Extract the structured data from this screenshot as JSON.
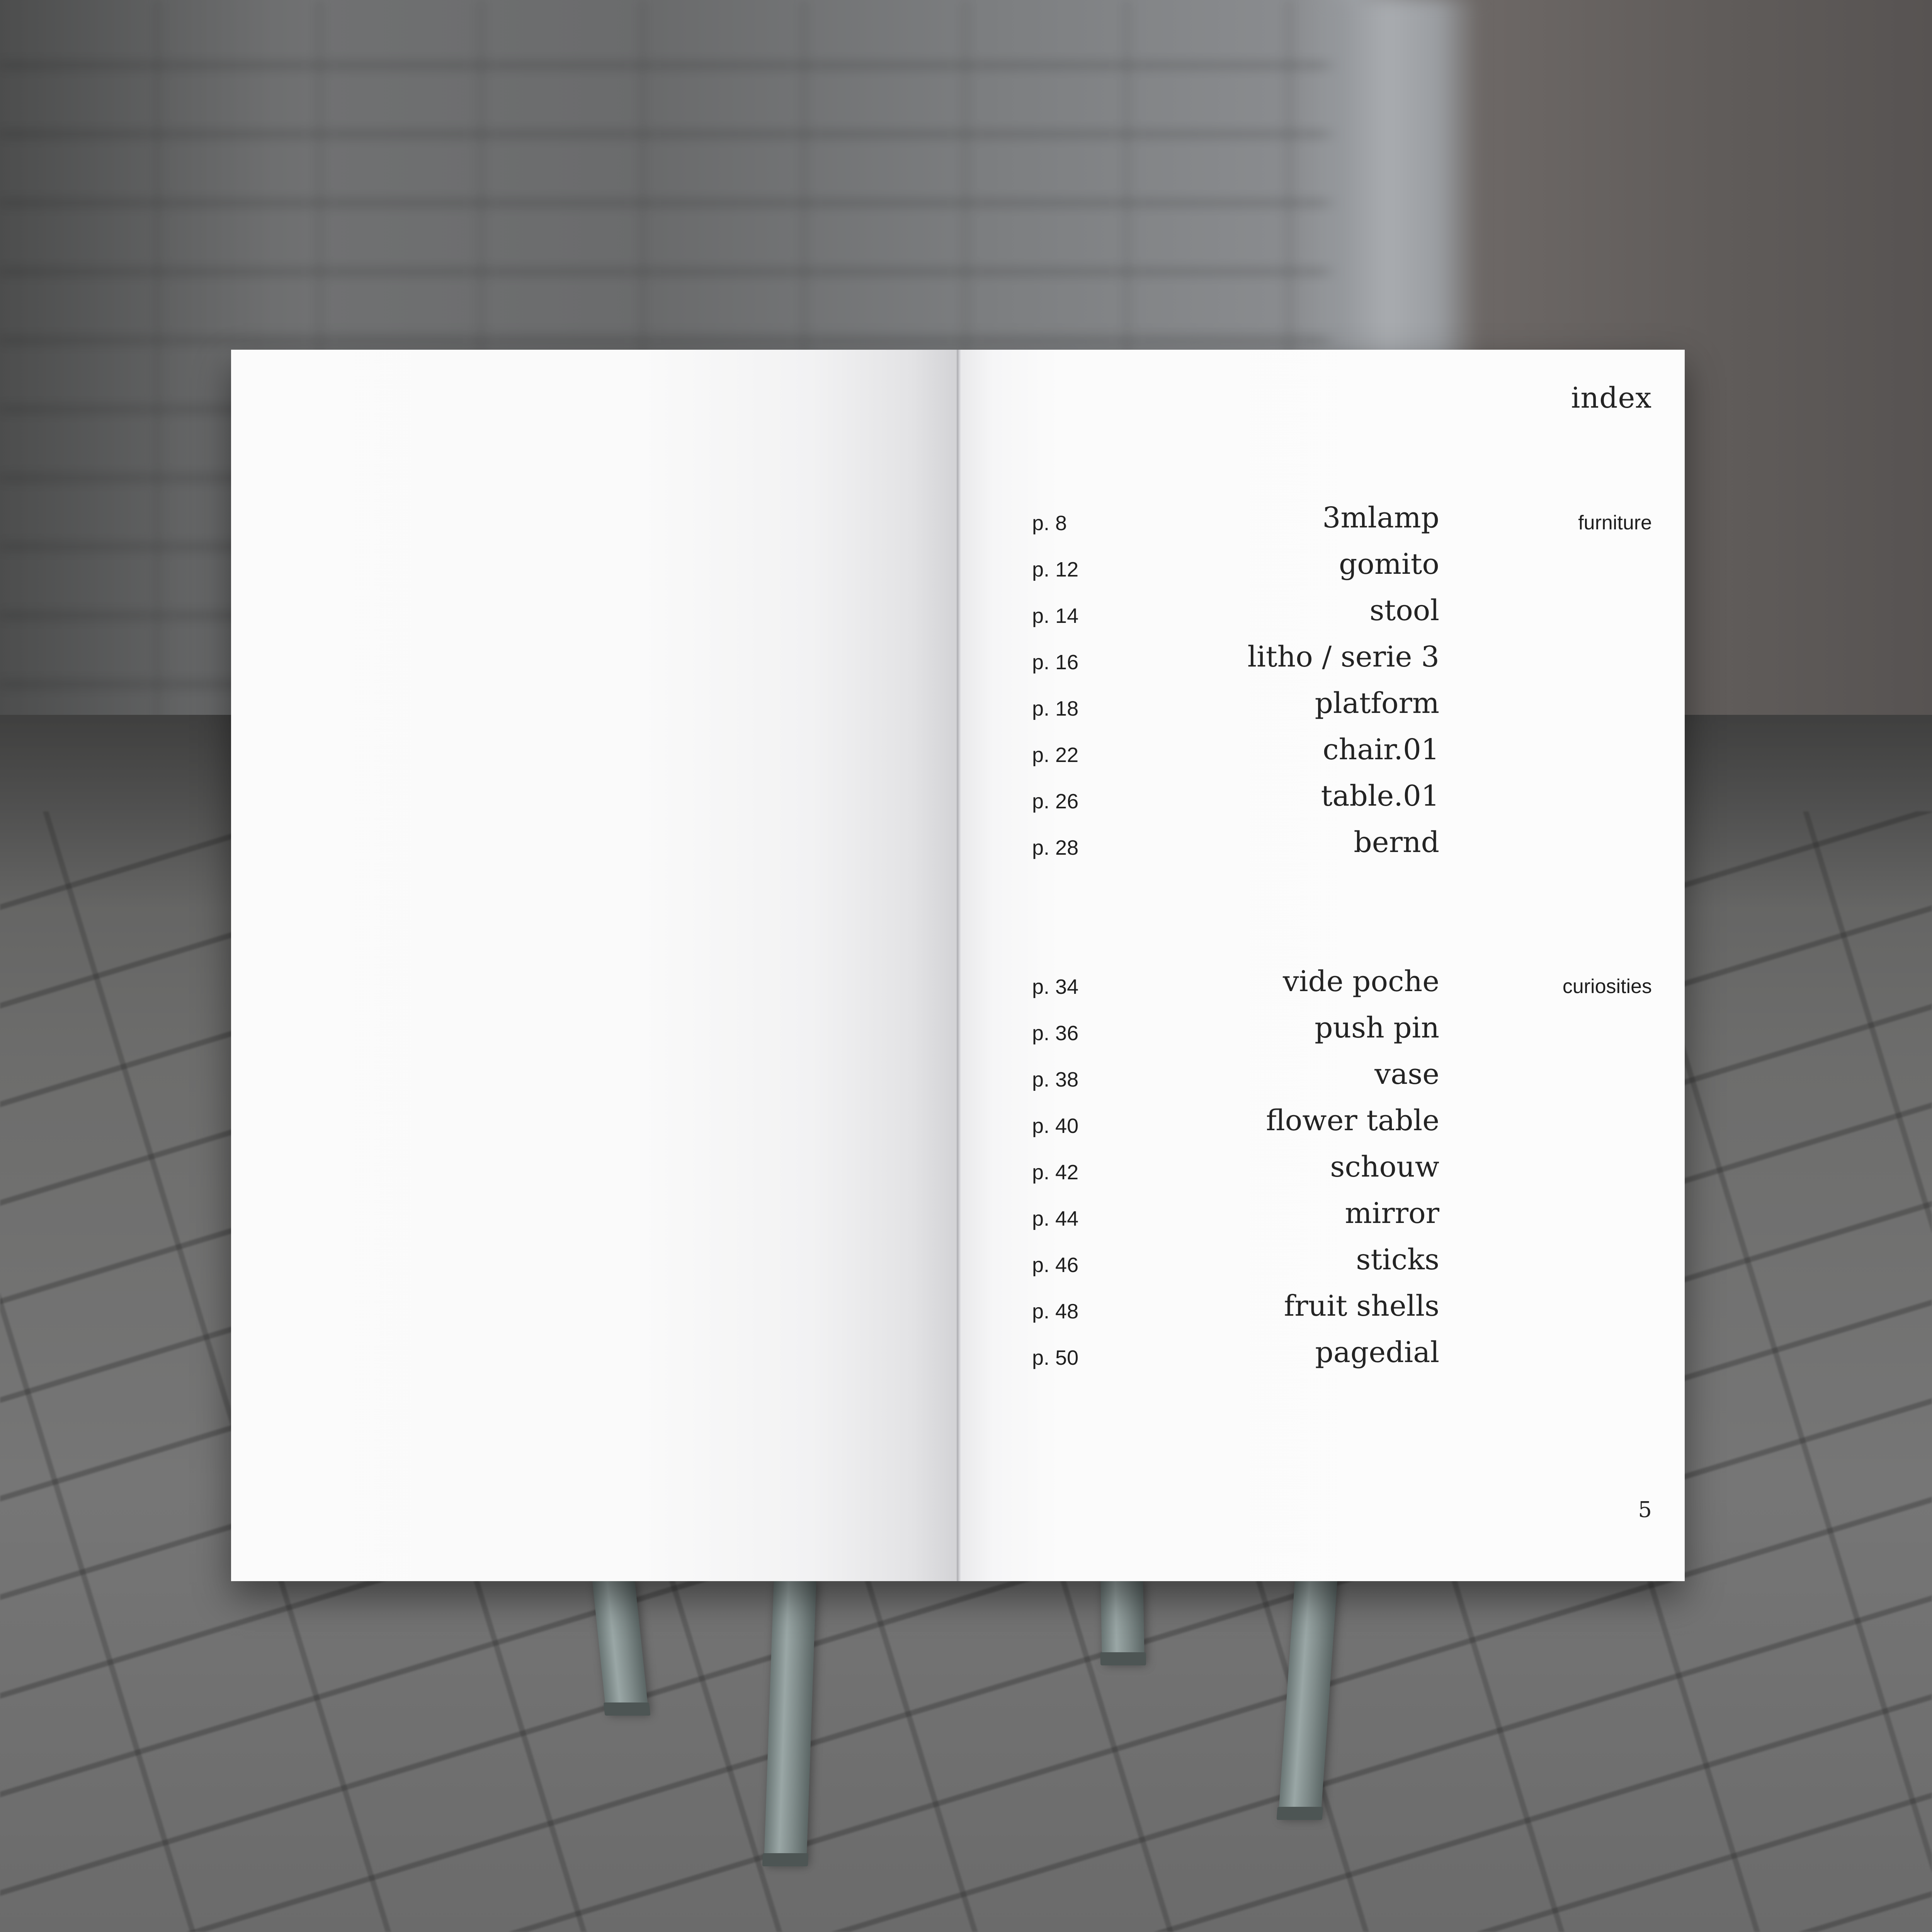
{
  "booklet": {
    "index_title": "index",
    "folio": "5",
    "sections": [
      {
        "label": "furniture",
        "entries": [
          {
            "page": "p. 8",
            "title": "3mlamp"
          },
          {
            "page": "p. 12",
            "title": "gomito"
          },
          {
            "page": "p. 14",
            "title": "stool"
          },
          {
            "page": "p. 16",
            "title": "litho / serie 3"
          },
          {
            "page": "p. 18",
            "title": "platform"
          },
          {
            "page": "p. 22",
            "title": "chair.01"
          },
          {
            "page": "p. 26",
            "title": "table.01"
          },
          {
            "page": "p. 28",
            "title": "bernd"
          }
        ]
      },
      {
        "label": "curiosities",
        "entries": [
          {
            "page": "p. 34",
            "title": "vide poche"
          },
          {
            "page": "p. 36",
            "title": "push pin"
          },
          {
            "page": "p. 38",
            "title": "vase"
          },
          {
            "page": "p. 40",
            "title": "flower table"
          },
          {
            "page": "p. 42",
            "title": "schouw"
          },
          {
            "page": "p. 44",
            "title": "mirror"
          },
          {
            "page": "p. 46",
            "title": "sticks"
          },
          {
            "page": "p. 48",
            "title": "fruit shells"
          },
          {
            "page": "p. 50",
            "title": "pagedial"
          }
        ]
      }
    ]
  },
  "colors": {
    "paper": "#fbfbfb",
    "ink": "#232323",
    "stand": "#8a9695"
  }
}
